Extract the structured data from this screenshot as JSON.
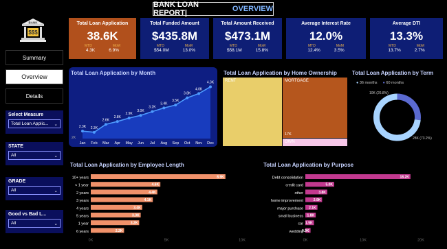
{
  "header": {
    "title": "BANK LOAN REPORT|",
    "subtitle": "OVERVIEW"
  },
  "logo": {
    "text": "BANK"
  },
  "nav": [
    {
      "label": "Summary"
    },
    {
      "label": "Overview"
    },
    {
      "label": "Details"
    }
  ],
  "filters": [
    {
      "label": "Select Measure",
      "value": "Total Loan Applic..."
    },
    {
      "label": "STATE",
      "value": "All"
    },
    {
      "label": "GRADE",
      "value": "All"
    },
    {
      "label": "Good vs Bad L...",
      "value": "All"
    }
  ],
  "kpis": [
    {
      "title": "Total Loan Application",
      "value": "38.6K",
      "mtd_label": "MTD",
      "mom_label": "MoM",
      "mtd": "4.3K",
      "mom": "6.9%"
    },
    {
      "title": "Total Funded Amount",
      "value": "$435.8M",
      "mtd_label": "MTD",
      "mom_label": "MoM",
      "mtd": "$54.0M",
      "mom": "13.0%"
    },
    {
      "title": "Total Amount Received",
      "value": "$473.1M",
      "mtd_label": "MTD",
      "mom_label": "MoM",
      "mtd": "$58.1M",
      "mom": "15.8%"
    },
    {
      "title": "Average Interest Rate",
      "value": "12.0%",
      "mtd_label": "MTD",
      "mom_label": "MoM",
      "mtd": "12.4%",
      "mom": "3.5%"
    },
    {
      "title": "Average DTI",
      "value": "13.3%",
      "mtd_label": "MTD",
      "mom_label": "MoM",
      "mtd": "13.7%",
      "mom": "2.7%"
    }
  ],
  "panels": {
    "month": "Total Loan Application by Month",
    "home": "Total Loan Application by Home Ownership",
    "term": "Total Loan Application by Term",
    "employee": "Total Loan Application by Employee Length",
    "purpose": "Total Loan Application by Purpose"
  },
  "chart_data": [
    {
      "type": "area",
      "title": "Total Loan Application by Month",
      "categories": [
        "Jan",
        "Feb",
        "Mar",
        "Apr",
        "May",
        "Jun",
        "Jul",
        "Aug",
        "Sep",
        "Oct",
        "Nov",
        "Dec"
      ],
      "labels": [
        "2.3K",
        "2.3K",
        "2.6K",
        "2.8K",
        "2.9K",
        "3.0K",
        "3.2K",
        "3.4K",
        "3.5K",
        "3.8K",
        "4.0K",
        "4.3K"
      ],
      "values": [
        2.33,
        2.28,
        2.63,
        2.76,
        2.91,
        3.03,
        3.2,
        3.36,
        3.49,
        3.81,
        4.0,
        4.3
      ],
      "ylim": [
        2,
        4.5
      ],
      "y_tick": "2K"
    },
    {
      "type": "treemap",
      "title": "Total Loan Application by Home Ownership",
      "items": [
        {
          "label": "RENT",
          "value": 18.4
        },
        {
          "label": "MORTGAGE",
          "value": 17.2
        },
        {
          "label": "OWN",
          "value": 2.8
        }
      ],
      "value_labels": {
        "MORTGAGE": "17K"
      }
    },
    {
      "type": "pie",
      "title": "Total Loan Application by Term",
      "legend": [
        "36 months",
        "60 months"
      ],
      "values": [
        28.2,
        10.4
      ],
      "slice_labels": [
        "28K (73.2%)",
        "10K (26.8%)"
      ]
    },
    {
      "type": "bar",
      "title": "Total Loan Application by Employee Length",
      "categories": [
        "10+ years",
        "< 1 year",
        "2 years",
        "3 years",
        "4 years",
        "5 years",
        "1 year",
        "6 years"
      ],
      "values": [
        8.9,
        4.6,
        4.4,
        4.1,
        3.4,
        3.3,
        3.2,
        2.2
      ],
      "labels": [
        "8.9K",
        "4.6K",
        "4.4K",
        "4.1K",
        "3.4K",
        "3.3K",
        "3.2K",
        "2.2K"
      ],
      "xticks": [
        "0K",
        "5K",
        "10K"
      ],
      "xlim": [
        0,
        10
      ]
    },
    {
      "type": "bar",
      "title": "Total Loan Application by Purpose",
      "categories": [
        "Debt consolidation",
        "credit card",
        "other",
        "home improvement",
        "major purchase",
        "small business",
        "car",
        "wedding"
      ],
      "values": [
        18.2,
        5.0,
        3.8,
        2.9,
        2.1,
        1.8,
        1.5,
        0.9
      ],
      "labels": [
        "18.2K",
        "5.0K",
        "3.8K",
        "2.9K",
        "2.1K",
        "1.8K",
        "1.5K",
        "0.9K"
      ],
      "xticks": [
        "0K",
        "10K",
        "20K"
      ],
      "xlim": [
        0,
        20
      ]
    }
  ]
}
